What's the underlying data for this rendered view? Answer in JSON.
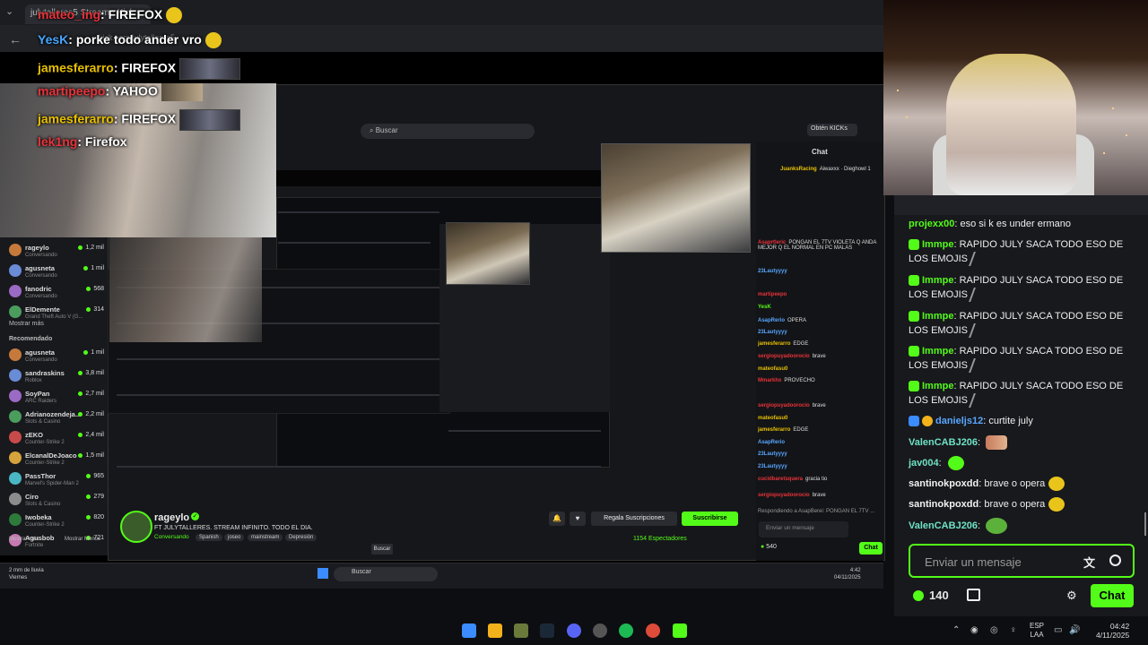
{
  "browser": {
    "tab_title": "julytalleres5 Stream - Kick",
    "address": "kick.com/julytalleres5"
  },
  "overlay_chat": [
    {
      "name": "mateo_ing",
      "msg": "FIREFOX",
      "color": "red",
      "emote": "face"
    },
    {
      "name": "YesK",
      "msg": "porke todo ander vro",
      "color": "blue",
      "emote": "face"
    },
    {
      "name": "jamesferarro",
      "msg": "FIREFOX",
      "color": "gold",
      "emote": "wide"
    },
    {
      "name": "martipeepo",
      "msg": "YAHOO",
      "color": "red",
      "emote": "small"
    },
    {
      "name": "jamesferarro",
      "msg": "FIREFOX",
      "color": "gold",
      "emote": "wide"
    },
    {
      "name": "lek1ng",
      "msg": "Firefox",
      "color": "red",
      "emote": "none"
    }
  ],
  "nested": {
    "search_placeholder": "Buscar",
    "kicks_button": "Obtén KICKs",
    "chat_title": "Chat",
    "sidebar": [
      {
        "name": "rageylo",
        "sub": "Conversando",
        "count": "1,2 mil"
      },
      {
        "name": "agusneta",
        "sub": "Conversando",
        "count": "1 mil"
      },
      {
        "name": "fanodric",
        "sub": "Conversando",
        "count": "568"
      },
      {
        "name": "ElDemente",
        "sub": "Grand Theft Auto V (G...",
        "count": "314"
      }
    ],
    "show_more": "Mostrar más",
    "recommended_title": "Recomendado",
    "recommended": [
      {
        "name": "agusneta",
        "sub": "Conversando",
        "count": "1 mil"
      },
      {
        "name": "sandraskins",
        "sub": "Roblox",
        "count": "3,8 mil"
      },
      {
        "name": "SoyPan",
        "sub": "ARC Raiders",
        "count": "2,7 mil"
      },
      {
        "name": "Adrianozendeja...",
        "sub": "Slots & Casino",
        "count": "2,2 mil"
      },
      {
        "name": "zEKO",
        "sub": "Counter-Strike 2",
        "count": "2,4 mil"
      },
      {
        "name": "ElcanalDeJoaco",
        "sub": "Counter-Strike 2",
        "count": "1,5 mil"
      },
      {
        "name": "PassThor",
        "sub": "Marvel's Spider-Man 2",
        "count": "965"
      },
      {
        "name": "Ciro",
        "sub": "Slots & Casino",
        "count": "279"
      },
      {
        "name": "Iwobeka",
        "sub": "Counter-Strike 2",
        "count": "820"
      },
      {
        "name": "Agusbob",
        "sub": "Fortnite",
        "count": "721"
      }
    ],
    "footer_more": "Mostrar más",
    "footer_less": "Mostrar Menos",
    "channel": {
      "name": "rageylo",
      "title": "FT JULYTALLERES. STREAM INFINITO. TODO EL DIA.",
      "category": "Conversando",
      "tags": [
        "Spanish",
        "joseo",
        "mainstream",
        "Depresión"
      ],
      "gift_label": "Regala Suscripciones",
      "sub_label": "Suscribirse",
      "viewers": "1154 Espectadores"
    },
    "chat_lines": [
      {
        "name": "JuanksRacing",
        "msg": "Aiwaxxx · Dieghowl 1"
      },
      {
        "name": "Asaprtleric",
        "msg": "PONGAN EL 7TV VIOLETA Q ANDA MEJOR Q EL NORMAL EN PC MALAS"
      },
      {
        "name": "23Lautyyyy",
        "msg": ""
      },
      {
        "name": "martipeepo",
        "msg": ""
      },
      {
        "name": "YesK",
        "msg": ""
      },
      {
        "name": "AsapRerio",
        "msg": "OPERA"
      },
      {
        "name": "23Lautyyyy",
        "msg": ""
      },
      {
        "name": "jamesferarro",
        "msg": "EDGE"
      },
      {
        "name": "sergiopuyadoorocio",
        "msg": "brave"
      },
      {
        "name": "mateofasu0",
        "msg": ""
      },
      {
        "name": "Mmarkhx",
        "msg": "PROVECHO"
      },
      {
        "name": "sergiopuyadoorocio",
        "msg": "brave"
      },
      {
        "name": "mateofasu0",
        "msg": ""
      },
      {
        "name": "jamesferarro",
        "msg": "EDGE"
      },
      {
        "name": "AsapRerio",
        "msg": ""
      },
      {
        "name": "23Lautyyyy",
        "msg": ""
      },
      {
        "name": "23Lautyyyy",
        "msg": ""
      },
      {
        "name": "cucidbaretsquera",
        "msg": "gracia tio"
      },
      {
        "name": "sergiopuyadoorocio",
        "msg": "brave"
      }
    ],
    "reply_text": "Respondiendo a AsapBerei: PONGAN EL 7TV ...",
    "chat_placeholder": "Enviar un mensaje",
    "points": "540",
    "chat_button": "Chat",
    "tooltip": "Buscar",
    "taskbar": {
      "weather_line1": "2 mm de lluvia",
      "weather_line2": "Viernes",
      "search": "Buscar",
      "time": "4:42",
      "date": "04/11/2025"
    }
  },
  "chat": {
    "messages": [
      {
        "name": "projexx00",
        "color": "green",
        "msg": "eso si k es under ermano",
        "badges": [],
        "emote": ""
      },
      {
        "name": "Immpe",
        "color": "green",
        "msg": "RAPIDO JULY SACA TODO ESO DE LOS EMOJIS",
        "badges": [
          "green"
        ],
        "emote": "stick"
      },
      {
        "name": "Immpe",
        "color": "green",
        "msg": "RAPIDO JULY SACA TODO ESO DE LOS EMOJIS",
        "badges": [
          "green"
        ],
        "emote": "stick"
      },
      {
        "name": "Immpe",
        "color": "green",
        "msg": "RAPIDO JULY SACA TODO ESO DE LOS EMOJIS",
        "badges": [
          "green"
        ],
        "emote": "stick"
      },
      {
        "name": "Immpe",
        "color": "green",
        "msg": "RAPIDO JULY SACA TODO ESO DE LOS EMOJIS",
        "badges": [
          "green"
        ],
        "emote": "stick"
      },
      {
        "name": "Immpe",
        "color": "green",
        "msg": "RAPIDO JULY SACA TODO ESO DE LOS EMOJIS",
        "badges": [
          "green"
        ],
        "emote": "stick"
      },
      {
        "name": "danieljs12",
        "color": "blue",
        "msg": "curtite july",
        "badges": [
          "blue",
          "gold"
        ],
        "emote": ""
      },
      {
        "name": "ValenCABJ206",
        "color": "teal",
        "msg": "",
        "badges": [],
        "emote": "pink"
      },
      {
        "name": "jav004",
        "color": "teal",
        "msg": "",
        "badges": [],
        "emote": "green"
      },
      {
        "name": "santinokpoxdd",
        "color": "white",
        "msg": "brave o opera",
        "badges": [],
        "emote": "face"
      },
      {
        "name": "santinokpoxdd",
        "color": "white",
        "msg": "brave o opera",
        "badges": [],
        "emote": "face"
      },
      {
        "name": "ValenCABJ206",
        "color": "teal",
        "msg": "",
        "badges": [],
        "emote": "frog"
      }
    ],
    "input_placeholder": "Enviar un mensaje",
    "points": "140",
    "send_button": "Chat"
  },
  "taskbar": {
    "lang_line1": "ESP",
    "lang_line2": "LAA",
    "time": "04:42",
    "date": "4/11/2025"
  },
  "colors": {
    "accent": "#53fc18",
    "name_gold": "#e8c000",
    "name_red": "#e8333a",
    "name_blue": "#47a5ff"
  }
}
